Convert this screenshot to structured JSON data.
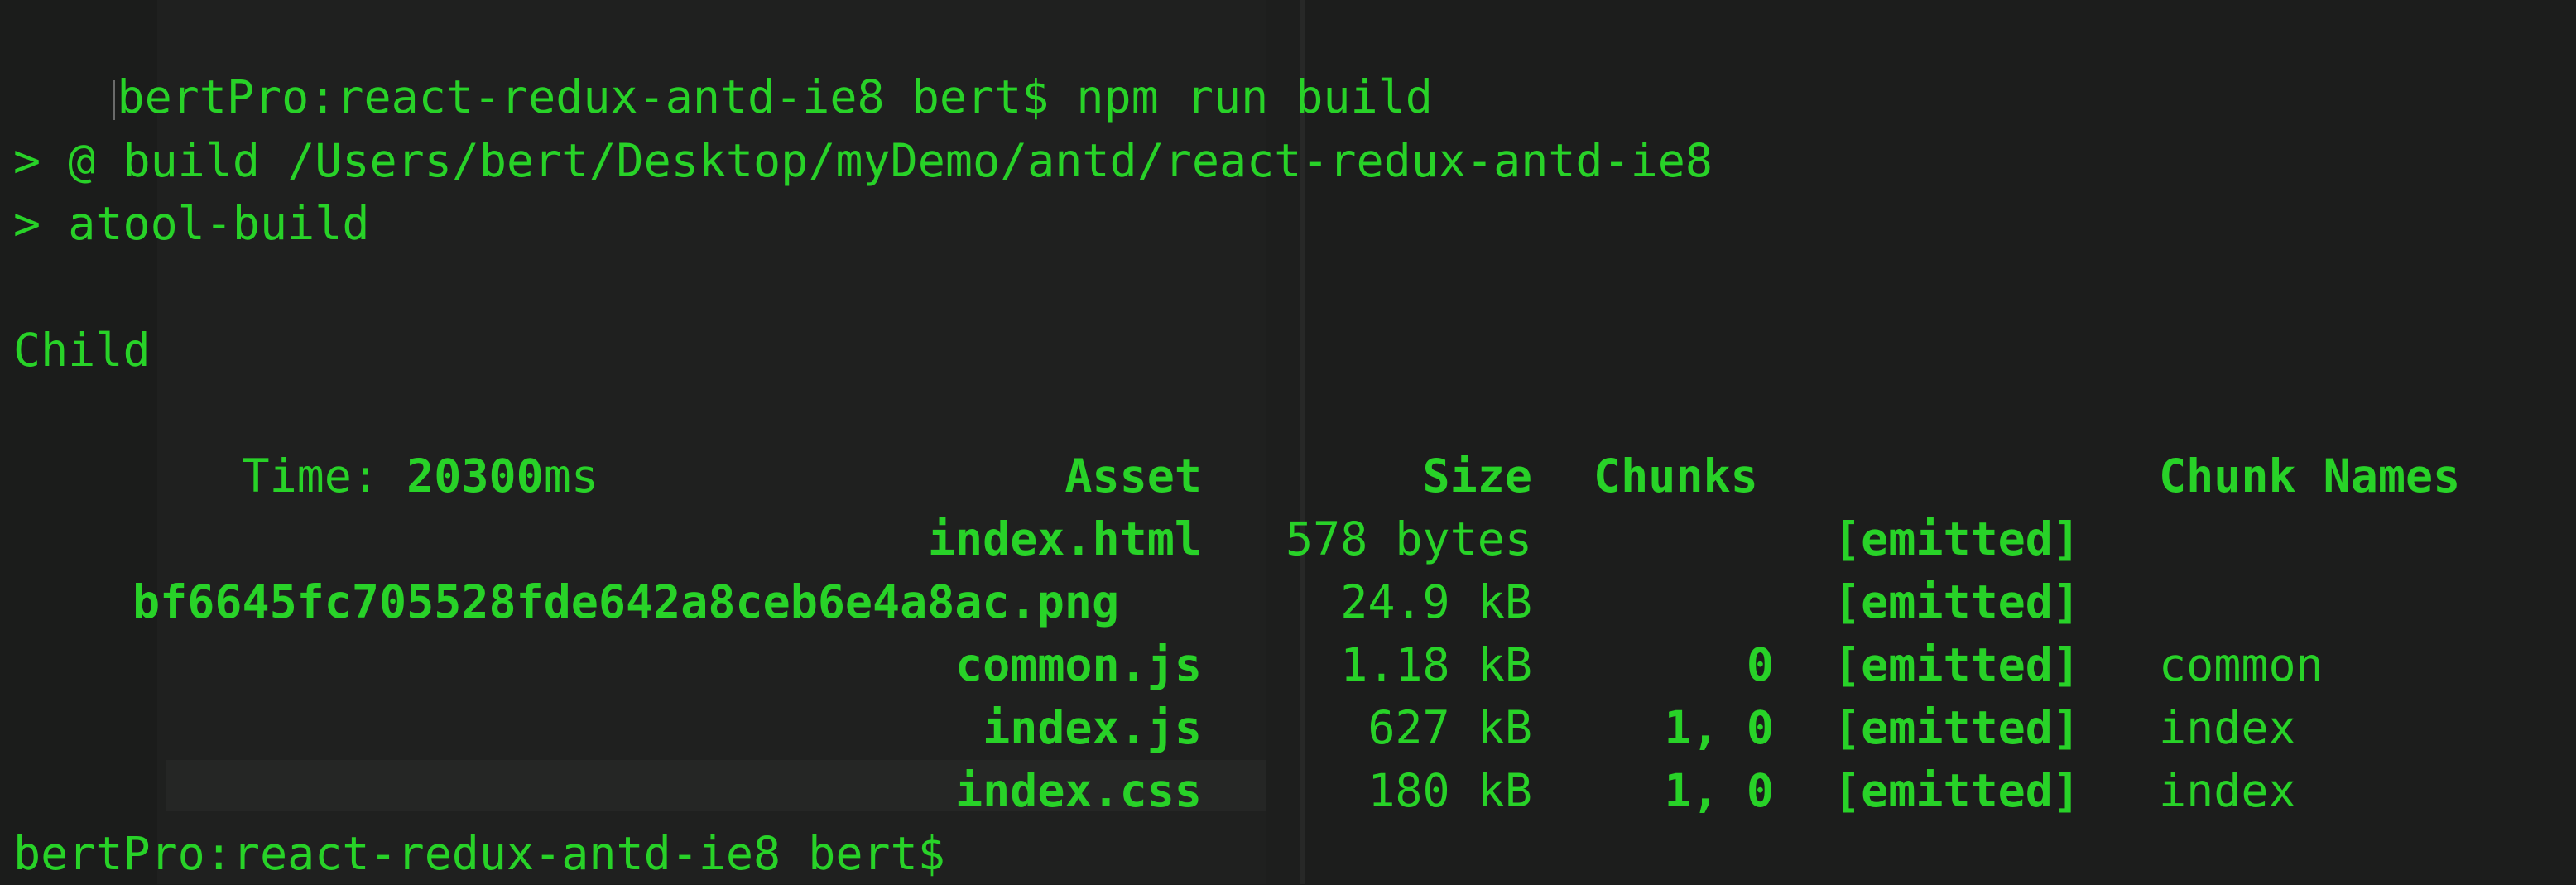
{
  "terminal": {
    "line_command": "bertPro:react-redux-antd-ie8 bert$ npm run build",
    "line_build_path": "> @ build /Users/bert/Desktop/myDemo/antd/react-redux-antd-ie8",
    "line_atool": "> atool-build",
    "child_label": "Child",
    "time_label": "Time: ",
    "time_value": "20300",
    "time_unit": "ms",
    "table": {
      "headers": {
        "asset": "Asset",
        "size": "Size",
        "chunks": "Chunks",
        "chunk_names": "Chunk Names"
      },
      "rows": [
        {
          "asset": "index.html",
          "size": "578 bytes",
          "chunks": "",
          "emitted": "[emitted]",
          "chunk_name": ""
        },
        {
          "asset": "bf6645fc705528fde642a8ceb6e4a8ac.png",
          "size": "24.9 kB",
          "chunks": "",
          "emitted": "[emitted]",
          "chunk_name": ""
        },
        {
          "asset": "common.js",
          "size": "1.18 kB",
          "chunks": "0",
          "emitted": "[emitted]",
          "chunk_name": "common"
        },
        {
          "asset": "index.js",
          "size": "627 kB",
          "chunks": "1, 0",
          "emitted": "[emitted]",
          "chunk_name": "index"
        },
        {
          "asset": "index.css",
          "size": "180 kB",
          "chunks": "1, 0",
          "emitted": "[emitted]",
          "chunk_name": "index"
        }
      ]
    },
    "line_prompt": "bertPro:react-redux-antd-ie8 bert$"
  },
  "colors": {
    "text_green": "#28d228",
    "background": "#1b1c1b"
  }
}
